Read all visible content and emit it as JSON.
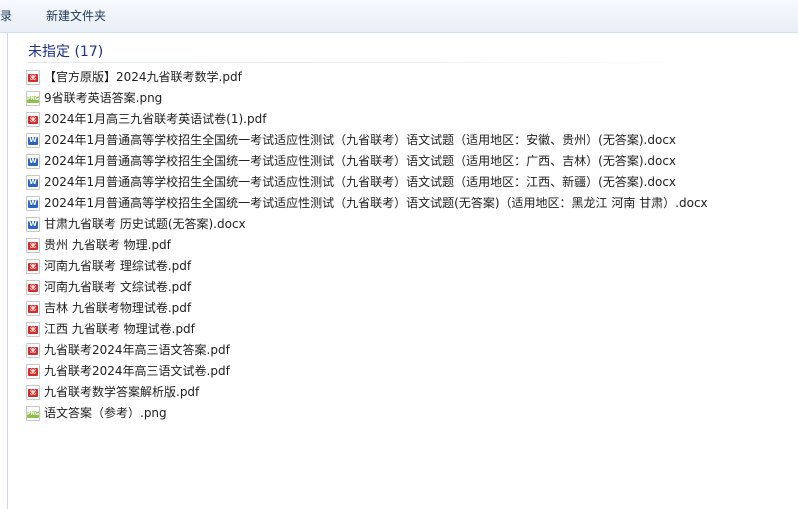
{
  "toolbar": {
    "items": [
      {
        "label": "刻录"
      },
      {
        "label": "新建文件夹"
      }
    ]
  },
  "group": {
    "title": "未指定 (17)"
  },
  "files": [
    {
      "name": "【官方原版】2024九省联考数学.pdf",
      "type": "pdf",
      "icon": "pdf-file-icon"
    },
    {
      "name": "9省联考英语答案.png",
      "type": "png",
      "icon": "png-file-icon"
    },
    {
      "name": "2024年1月高三九省联考英语试卷(1).pdf",
      "type": "pdf",
      "icon": "pdf-file-icon"
    },
    {
      "name": "2024年1月普通高等学校招生全国统一考试适应性测试（九省联考）语文试题（适用地区：安徽、贵州）(无答案).docx",
      "type": "docx",
      "icon": "word-file-icon"
    },
    {
      "name": "2024年1月普通高等学校招生全国统一考试适应性测试（九省联考）语文试题（适用地区：广西、吉林）(无答案).docx",
      "type": "docx",
      "icon": "word-file-icon"
    },
    {
      "name": "2024年1月普通高等学校招生全国统一考试适应性测试（九省联考）语文试题（适用地区：江西、新疆）(无答案).docx",
      "type": "docx",
      "icon": "word-file-icon"
    },
    {
      "name": "2024年1月普通高等学校招生全国统一考试适应性测试（九省联考）语文试题(无答案)（适用地区：黑龙江 河南 甘肃）.docx",
      "type": "docx",
      "icon": "word-file-icon"
    },
    {
      "name": "甘肃九省联考 历史试题(无答案).docx",
      "type": "docx",
      "icon": "word-file-icon"
    },
    {
      "name": "贵州 九省联考 物理.pdf",
      "type": "pdf",
      "icon": "pdf-file-icon"
    },
    {
      "name": "河南九省联考 理综试卷.pdf",
      "type": "pdf",
      "icon": "pdf-file-icon"
    },
    {
      "name": "河南九省联考 文综试卷.pdf",
      "type": "pdf",
      "icon": "pdf-file-icon"
    },
    {
      "name": "吉林 九省联考物理试卷.pdf",
      "type": "pdf",
      "icon": "pdf-file-icon"
    },
    {
      "name": "江西 九省联考 物理试卷.pdf",
      "type": "pdf",
      "icon": "pdf-file-icon"
    },
    {
      "name": "九省联考2024年高三语文答案.pdf",
      "type": "pdf",
      "icon": "pdf-file-icon"
    },
    {
      "name": "九省联考2024年高三语文试卷.pdf",
      "type": "pdf",
      "icon": "pdf-file-icon"
    },
    {
      "name": "九省联考数学答案解析版.pdf",
      "type": "pdf",
      "icon": "pdf-file-icon"
    },
    {
      "name": "语文答案（参考）.png",
      "type": "png",
      "icon": "png-file-icon"
    }
  ]
}
